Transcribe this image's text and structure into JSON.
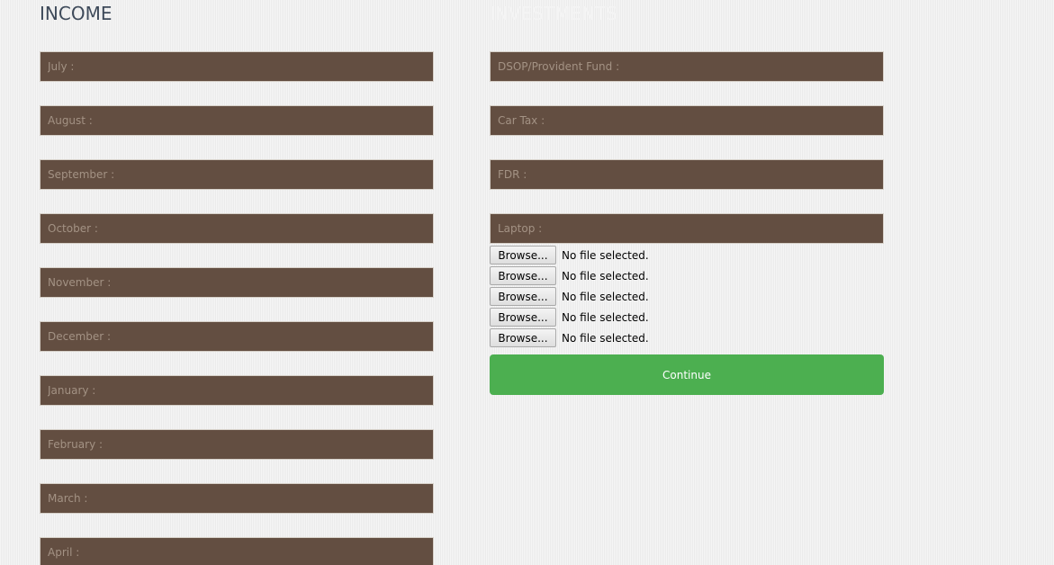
{
  "income": {
    "title": "INCOME",
    "fields": [
      {
        "placeholder": "July :",
        "value": ""
      },
      {
        "placeholder": "August :",
        "value": ""
      },
      {
        "placeholder": "September :",
        "value": ""
      },
      {
        "placeholder": "October :",
        "value": ""
      },
      {
        "placeholder": "November :",
        "value": ""
      },
      {
        "placeholder": "December :",
        "value": ""
      },
      {
        "placeholder": "January :",
        "value": ""
      },
      {
        "placeholder": "February :",
        "value": ""
      },
      {
        "placeholder": "March :",
        "value": ""
      },
      {
        "placeholder": "April :",
        "value": ""
      }
    ]
  },
  "investments": {
    "title": "INVESTMENTS",
    "fields": [
      {
        "placeholder": "DSOP/Provident Fund :",
        "value": ""
      },
      {
        "placeholder": "Car Tax :",
        "value": ""
      },
      {
        "placeholder": "FDR :",
        "value": ""
      },
      {
        "placeholder": "Laptop :",
        "value": ""
      }
    ],
    "file_inputs": [
      {
        "button_label": "Browse...",
        "status": "No file selected."
      },
      {
        "button_label": "Browse...",
        "status": "No file selected."
      },
      {
        "button_label": "Browse...",
        "status": "No file selected."
      },
      {
        "button_label": "Browse...",
        "status": "No file selected."
      },
      {
        "button_label": "Browse...",
        "status": "No file selected."
      }
    ],
    "continue_label": "Continue"
  },
  "colors": {
    "field_background": "#634e41",
    "placeholder_text": "#a39284",
    "continue_button": "#4caf50",
    "income_title": "#3e4a5a",
    "page_background": "#efefef"
  }
}
